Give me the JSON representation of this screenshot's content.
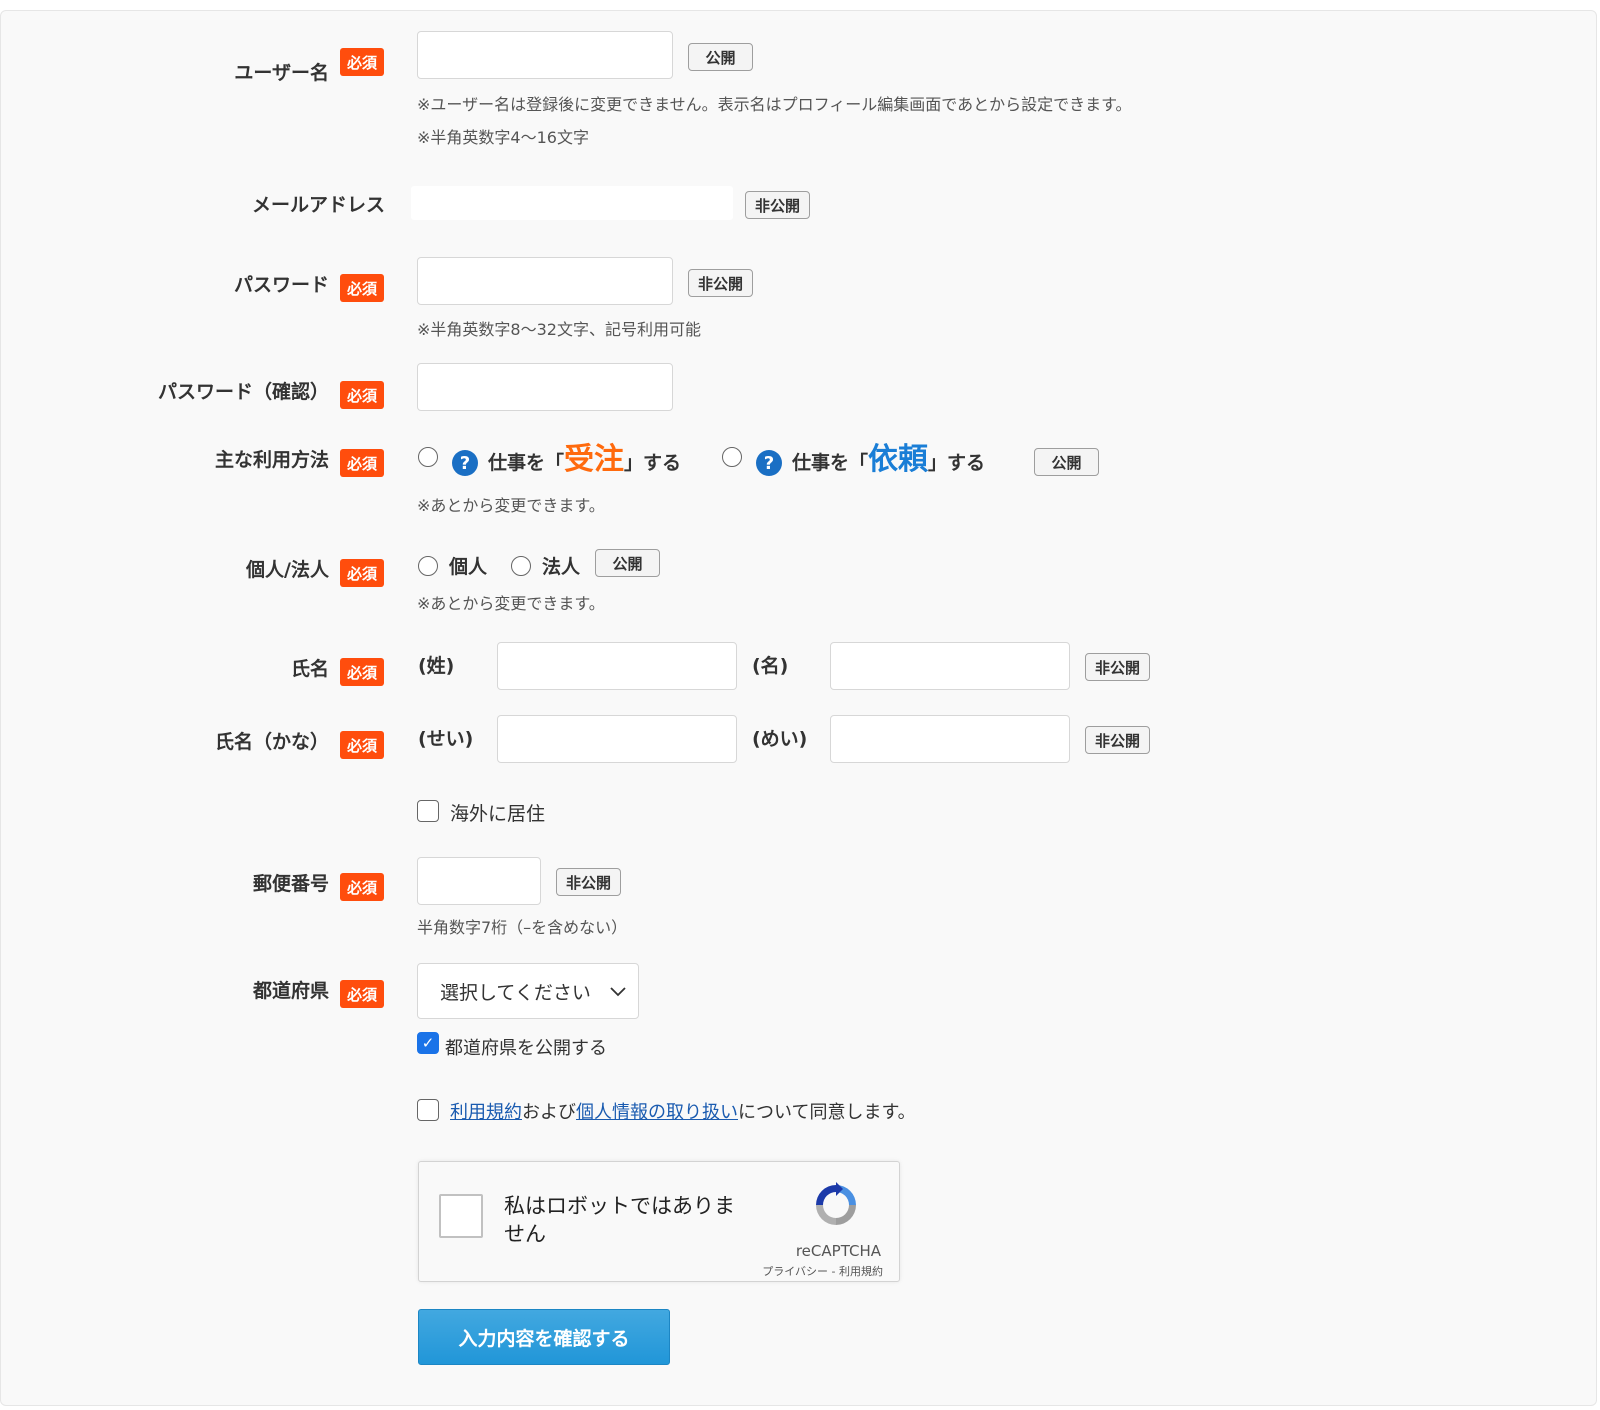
{
  "required_badge": "必須",
  "public_tag": "公開",
  "private_tag": "非公開",
  "username": {
    "label": "ユーザー名",
    "note1": "※ユーザー名は登録後に変更できません。表示名はプロフィール編集画面であとから設定できます。",
    "note2": "※半角英数字4〜16文字"
  },
  "email": {
    "label": "メールアドレス"
  },
  "password": {
    "label": "パスワード",
    "note": "※半角英数字8〜32文字、記号利用可能"
  },
  "password_confirm": {
    "label": "パスワード（確認）"
  },
  "usage": {
    "label": "主な利用方法",
    "option1_prefix": "仕事を「",
    "option1_emph": "受注",
    "option1_suffix": "」する",
    "option2_prefix": "仕事を「",
    "option2_emph": "依頼",
    "option2_suffix": "」する",
    "note": "※あとから変更できます。"
  },
  "entity": {
    "label": "個人/法人",
    "option1": "個人",
    "option2": "法人",
    "note": "※あとから変更できます。"
  },
  "name": {
    "label": "氏名",
    "last": "(姓)",
    "first": "(名)"
  },
  "name_kana": {
    "label": "氏名（かな）",
    "last": "(せい)",
    "first": "(めい)"
  },
  "overseas": {
    "label": "海外に居住",
    "checked": false
  },
  "postal": {
    "label": "郵便番号",
    "note": "半角数字7桁（–を含めない）"
  },
  "prefecture": {
    "label": "都道府県",
    "selected": "選択してください",
    "publish_label": "都道府県を公開する",
    "publish_checked": true
  },
  "agreement": {
    "terms_link": "利用規約",
    "and": "および",
    "privacy_link": "個人情報の取り扱い",
    "suffix": "について同意します。",
    "checked": false
  },
  "recaptcha": {
    "text": "私はロボットではありません",
    "brand": "reCAPTCHA",
    "links": "プライバシー - 利用規約"
  },
  "submit_label": "入力内容を確認する",
  "colors": {
    "required": "#ff4d0d",
    "accent_orange": "#ff6a0d",
    "accent_blue": "#1a7ed6",
    "button": "#2196d8"
  }
}
